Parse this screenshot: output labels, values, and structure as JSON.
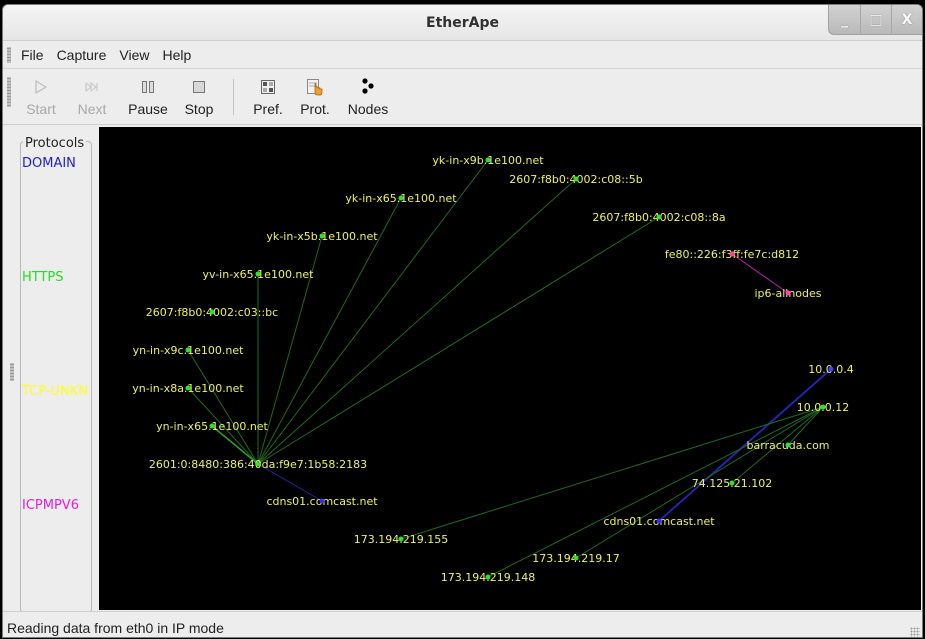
{
  "window": {
    "title": "EtherApe",
    "controls": {
      "minimize": "_",
      "maximize": "□",
      "close": "X"
    }
  },
  "menu": [
    "File",
    "Capture",
    "View",
    "Help"
  ],
  "toolbar": {
    "start": {
      "label": "Start",
      "icon": "play-icon",
      "enabled": false
    },
    "next": {
      "label": "Next",
      "icon": "skip-forward-icon",
      "enabled": false
    },
    "pause": {
      "label": "Pause",
      "icon": "pause-icon",
      "enabled": true
    },
    "stop": {
      "label": "Stop",
      "icon": "stop-icon",
      "enabled": true
    },
    "pref": {
      "label": "Pref.",
      "icon": "preferences-icon",
      "enabled": true
    },
    "prot": {
      "label": "Prot.",
      "icon": "protocols-icon",
      "enabled": true
    },
    "nodes": {
      "label": "Nodes",
      "icon": "nodes-icon",
      "enabled": true
    }
  },
  "protocols": {
    "title": "Protocols",
    "items": [
      {
        "name": "DOMAIN",
        "color": "#2020d0"
      },
      {
        "name": "HTTPS",
        "color": "#20e020"
      },
      {
        "name": "TCP-UNKN",
        "color": "#ffff20"
      },
      {
        "name": "ICPMPV6",
        "color": "#e020e0"
      }
    ]
  },
  "graph": {
    "label_color": "#f0f060",
    "nodes": [
      {
        "id": "n1",
        "label": "yk-in-x9b.1e100.net"
      },
      {
        "id": "n2",
        "label": "2607:f8b0:4002:c08::5b"
      },
      {
        "id": "n3",
        "label": "yk-in-x65.1e100.net"
      },
      {
        "id": "n4",
        "label": "2607:f8b0:4002:c08::8a"
      },
      {
        "id": "n5",
        "label": "yk-in-x5b.1e100.net"
      },
      {
        "id": "n6",
        "label": "fe80::226:f3ff:fe7c:d812"
      },
      {
        "id": "n7",
        "label": "yv-in-x65.1e100.net"
      },
      {
        "id": "n8",
        "label": "ip6-allnodes"
      },
      {
        "id": "n9",
        "label": "2607:f8b0:4002:c03::bc"
      },
      {
        "id": "n10",
        "label": "yn-in-x9c.1e100.net"
      },
      {
        "id": "n11",
        "label": "10.0.0.4"
      },
      {
        "id": "n12",
        "label": "yn-in-x8a.1e100.net"
      },
      {
        "id": "n13",
        "label": "10.0.0.12"
      },
      {
        "id": "n14",
        "label": "yn-in-x65.1e100.net"
      },
      {
        "id": "n15",
        "label": "barracuda.com"
      },
      {
        "id": "n16",
        "label": "2601:0:8480:386:40da:f9e7:1b58:2183"
      },
      {
        "id": "n17",
        "label": "74.125.21.102"
      },
      {
        "id": "n18",
        "label": "cdns01.comcast.net"
      },
      {
        "id": "n19",
        "label": "cdns01.comcast.net"
      },
      {
        "id": "n20",
        "label": "173.194.219.155"
      },
      {
        "id": "n21",
        "label": "173.194.219.17"
      },
      {
        "id": "n22",
        "label": "173.194.219.148"
      }
    ],
    "links": [
      {
        "from": "n16",
        "to": "n1",
        "protocol": "HTTPS"
      },
      {
        "from": "n16",
        "to": "n2",
        "protocol": "HTTPS"
      },
      {
        "from": "n16",
        "to": "n3",
        "protocol": "HTTPS"
      },
      {
        "from": "n16",
        "to": "n4",
        "protocol": "HTTPS"
      },
      {
        "from": "n16",
        "to": "n5",
        "protocol": "HTTPS"
      },
      {
        "from": "n16",
        "to": "n7",
        "protocol": "HTTPS"
      },
      {
        "from": "n16",
        "to": "n10",
        "protocol": "HTTPS"
      },
      {
        "from": "n16",
        "to": "n12",
        "protocol": "HTTPS"
      },
      {
        "from": "n16",
        "to": "n14",
        "protocol": "HTTPS"
      },
      {
        "from": "n16",
        "to": "n18",
        "protocol": "DOMAIN"
      },
      {
        "from": "n6",
        "to": "n8",
        "protocol": "ICPMPV6"
      },
      {
        "from": "n11",
        "to": "n19",
        "protocol": "DOMAIN"
      },
      {
        "from": "n13",
        "to": "n20",
        "protocol": "HTTPS"
      },
      {
        "from": "n13",
        "to": "n21",
        "protocol": "HTTPS"
      },
      {
        "from": "n13",
        "to": "n22",
        "protocol": "HTTPS"
      },
      {
        "from": "n13",
        "to": "n15",
        "protocol": "HTTPS"
      },
      {
        "from": "n13",
        "to": "n17",
        "protocol": "HTTPS"
      }
    ]
  },
  "status": {
    "text": "Reading data from eth0 in IP mode"
  }
}
